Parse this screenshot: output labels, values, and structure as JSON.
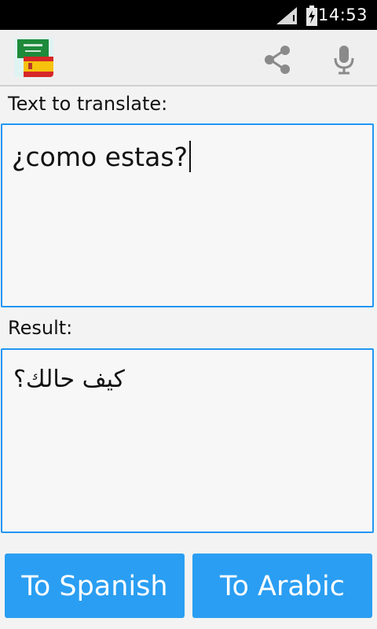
{
  "status_bar": {
    "time": "14:53",
    "icons": [
      "signal-icon",
      "battery-charging-icon"
    ]
  },
  "app_bar": {
    "app_icon": "saudi-spain-flags-icon",
    "actions": [
      "share-icon",
      "microphone-icon"
    ]
  },
  "input_section": {
    "label": "Text to translate:",
    "value": "¿como estas?"
  },
  "result_section": {
    "label": "Result:",
    "value": "كيف حالك؟"
  },
  "buttons": {
    "to_spanish": "To Spanish",
    "to_arabic": "To Arabic"
  },
  "colors": {
    "accent": "#2196f3",
    "button_bg": "#2a9ef2",
    "status_bar_bg": "#000000",
    "background": "#f3f3f3"
  }
}
